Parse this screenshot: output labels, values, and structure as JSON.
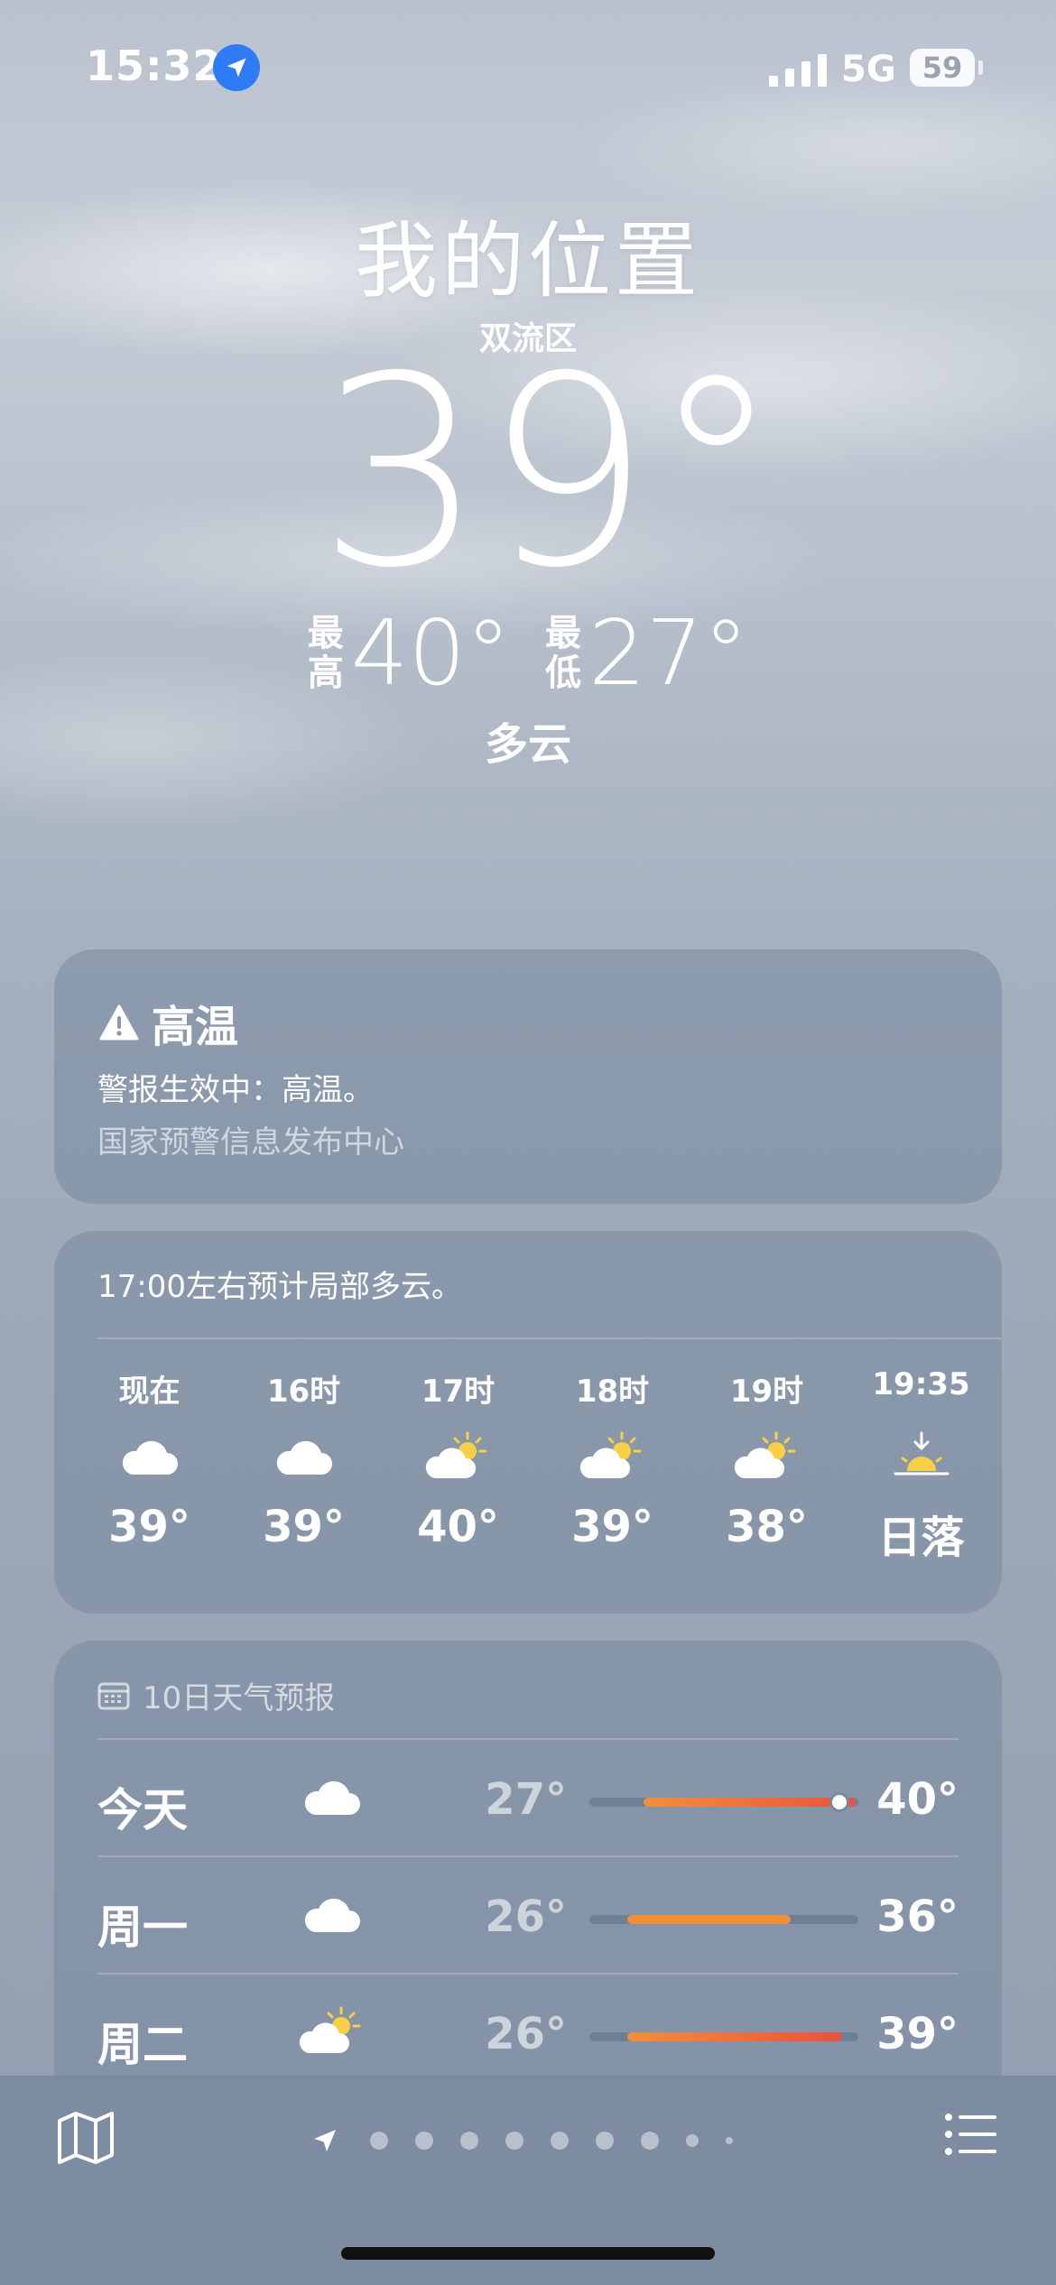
{
  "status_bar": {
    "time": "15:32",
    "network": "5G",
    "battery": "59"
  },
  "header": {
    "location": "我的位置",
    "district": "双流区",
    "temperature": "39°",
    "high_label": "最高",
    "high": "40°",
    "low_label": "最低",
    "low": "27°",
    "condition": "多云"
  },
  "alert": {
    "title": "高温",
    "body": "警报生效中：高温。",
    "source": "国家预警信息发布中心"
  },
  "hourly": {
    "summary": "17:00左右预计局部多云。",
    "items": [
      {
        "label": "现在",
        "icon": "cloud-icon",
        "temp": "39°"
      },
      {
        "label": "16时",
        "icon": "cloud-icon",
        "temp": "39°"
      },
      {
        "label": "17时",
        "icon": "partly-sunny-icon",
        "temp": "40°"
      },
      {
        "label": "18时",
        "icon": "partly-sunny-icon",
        "temp": "39°"
      },
      {
        "label": "19时",
        "icon": "partly-sunny-icon",
        "temp": "38°"
      },
      {
        "label": "19:35",
        "icon": "sunset-icon",
        "temp": "日落"
      }
    ]
  },
  "daily": {
    "heading": "10日天气预报",
    "range": [
      26,
      40
    ],
    "rows": [
      {
        "day": "今天",
        "icon": "cloud-icon",
        "low": "27°",
        "high": "40°",
        "low_value": 27,
        "high_value": 40,
        "current_value": 39
      },
      {
        "day": "周一",
        "icon": "cloud-icon",
        "low": "26°",
        "high": "36°",
        "low_value": 26,
        "high_value": 36
      },
      {
        "day": "周二",
        "icon": "partly-sunny-icon",
        "low": "26°",
        "high": "39°",
        "low_value": 26,
        "high_value": 39
      }
    ]
  },
  "toolbar": {
    "page_count": 9,
    "current_page": 0
  },
  "colors": {
    "accent_blue": "#2f7bf6",
    "bar_orange": "#f28f3b",
    "bar_red": "#e8533d",
    "sun_yellow": "#f7d046"
  }
}
